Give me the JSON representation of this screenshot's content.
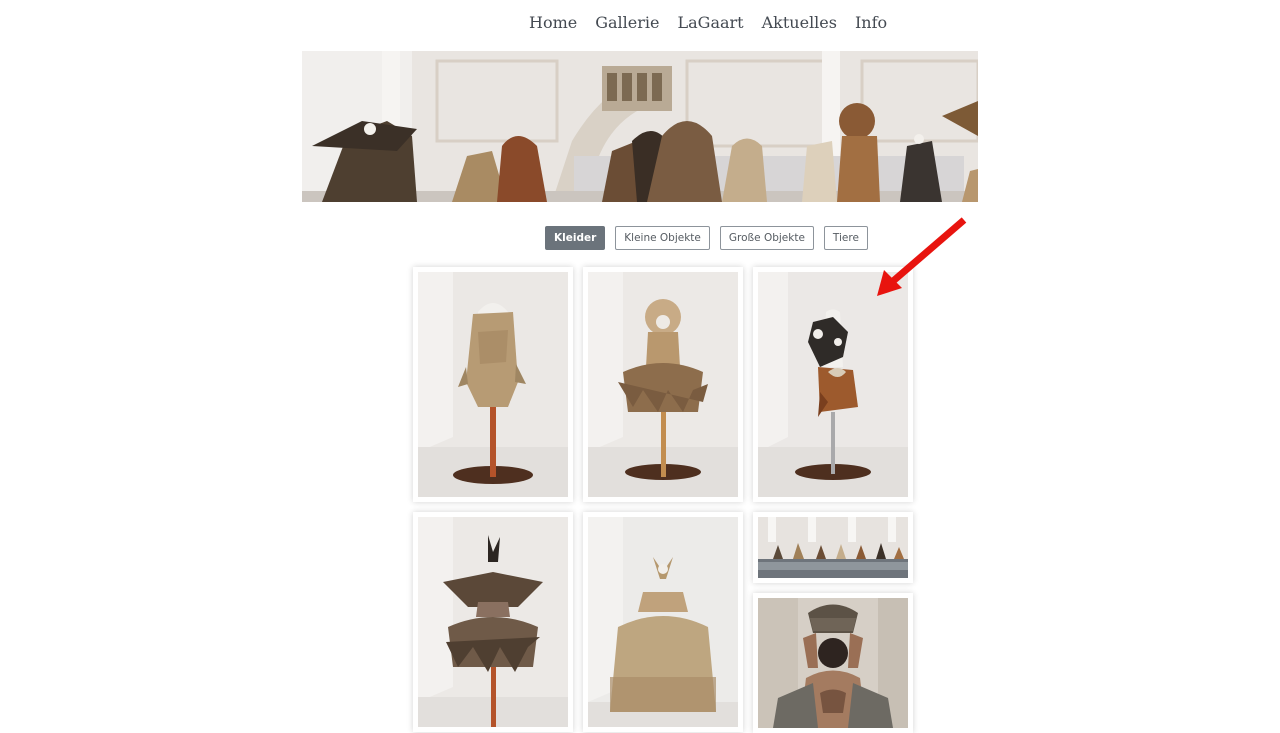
{
  "nav": {
    "items": [
      {
        "label": "Home"
      },
      {
        "label": "Gallerie"
      },
      {
        "label": "LaGaart"
      },
      {
        "label": "Aktuelles"
      },
      {
        "label": "Info"
      }
    ]
  },
  "filters": {
    "active": "Kleider",
    "items": [
      {
        "label": "Kleider"
      },
      {
        "label": "Kleine Objekte"
      },
      {
        "label": "Große Objekte"
      },
      {
        "label": "Tiere"
      }
    ]
  },
  "gallery": {
    "items": [
      {
        "subject": "dress on mannequin, papery top"
      },
      {
        "subject": "dress on mannequin, feathered skirt"
      },
      {
        "subject": "dress on mannequin, dark ornament top"
      },
      {
        "subject": "dress on mannequin, feather wings"
      },
      {
        "subject": "dress on mannequin, straw ball gown"
      },
      {
        "subject": "exhibition hall with dresses"
      },
      {
        "subject": "model carrying basket"
      }
    ]
  },
  "annotation": {
    "color": "#e8140f"
  }
}
